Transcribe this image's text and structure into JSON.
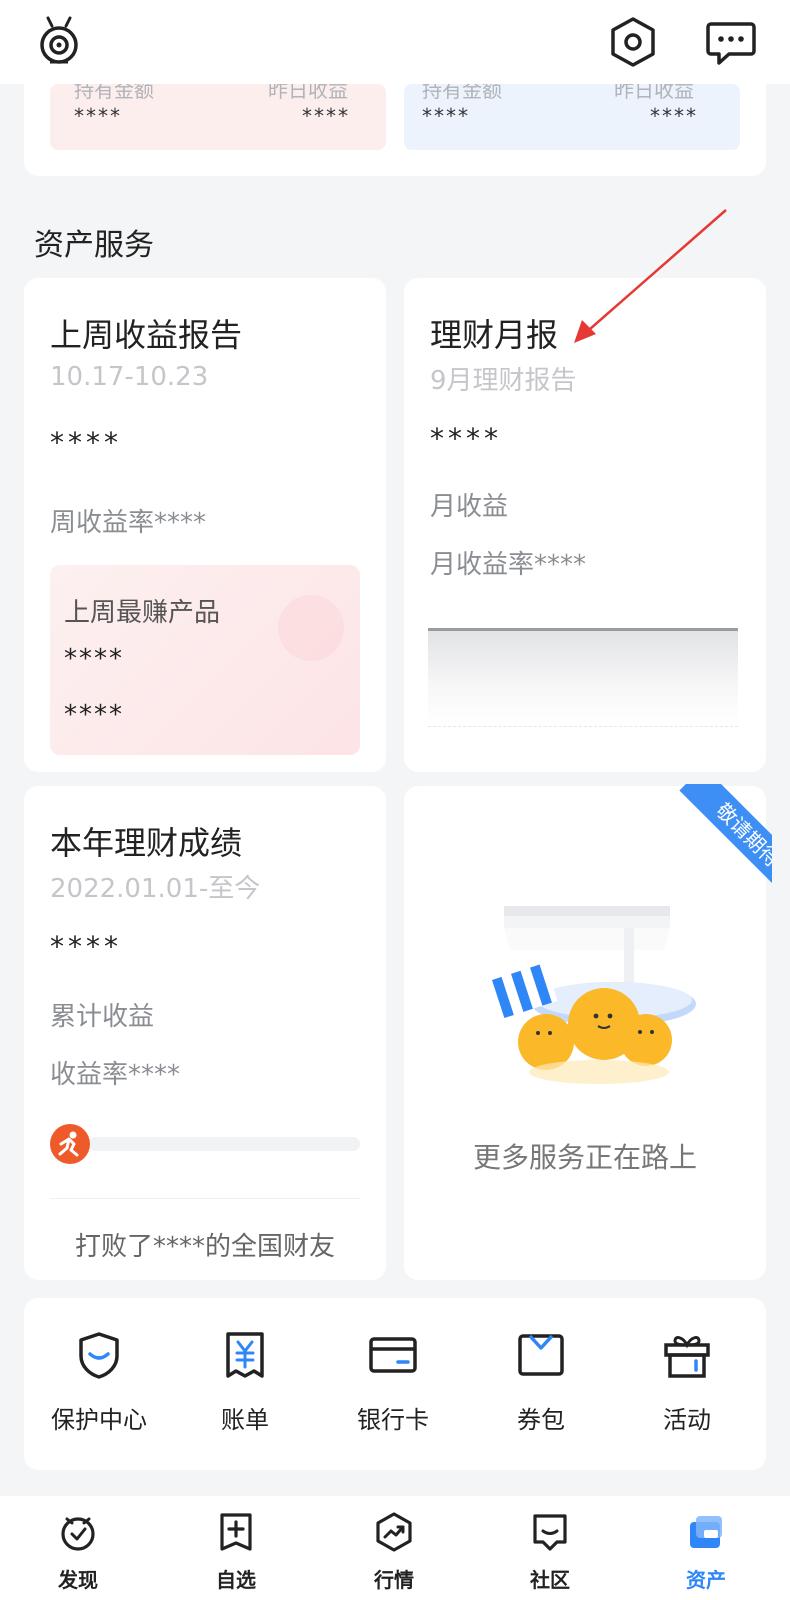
{
  "holdings": {
    "left": {
      "held_label": "持有金额",
      "yesterday_label": "昨日收益",
      "held_value": "****",
      "yesterday_value": "****"
    },
    "right": {
      "held_label": "持有金额",
      "yesterday_label": "昨日收益",
      "held_value": "****",
      "yesterday_value": "****"
    }
  },
  "section": {
    "title": "资产服务"
  },
  "weekly_report": {
    "title": "上周收益报告",
    "date_range": "10.17-10.23",
    "amount": "****",
    "rate_label": "周收益率****",
    "best_product_title": "上周最赚产品",
    "best_line1": "****",
    "best_line2": "****"
  },
  "monthly_report": {
    "title": "理财月报",
    "subtitle": "9月理财报告",
    "amount": "****",
    "income_label": "月收益",
    "rate_label": "月收益率****"
  },
  "annual": {
    "title": "本年理财成绩",
    "date_range": "2022.01.01-至今",
    "amount": "****",
    "cumulative_label": "累计收益",
    "rate_label": "收益率****",
    "rank_text": "打败了****的全国财友"
  },
  "coming_soon": {
    "ribbon": "敬请期待",
    "text": "更多服务正在路上"
  },
  "tools": [
    {
      "label": "保护中心",
      "icon": "shield-icon"
    },
    {
      "label": "账单",
      "icon": "bill-icon"
    },
    {
      "label": "银行卡",
      "icon": "bank-card-icon"
    },
    {
      "label": "券包",
      "icon": "coupon-wallet-icon"
    },
    {
      "label": "活动",
      "icon": "gift-icon"
    }
  ],
  "bottom_nav": [
    {
      "label": "发现",
      "icon": "discover-icon"
    },
    {
      "label": "自选",
      "icon": "watchlist-icon"
    },
    {
      "label": "行情",
      "icon": "market-icon"
    },
    {
      "label": "社区",
      "icon": "community-icon"
    },
    {
      "label": "资产",
      "icon": "assets-icon",
      "active": true
    }
  ],
  "colors": {
    "accent": "#2f86f6",
    "pink_box": "#fdeeee",
    "blue_box": "#ecf3fd",
    "arrow": "#e53935",
    "progress": "#ef5a2b"
  }
}
